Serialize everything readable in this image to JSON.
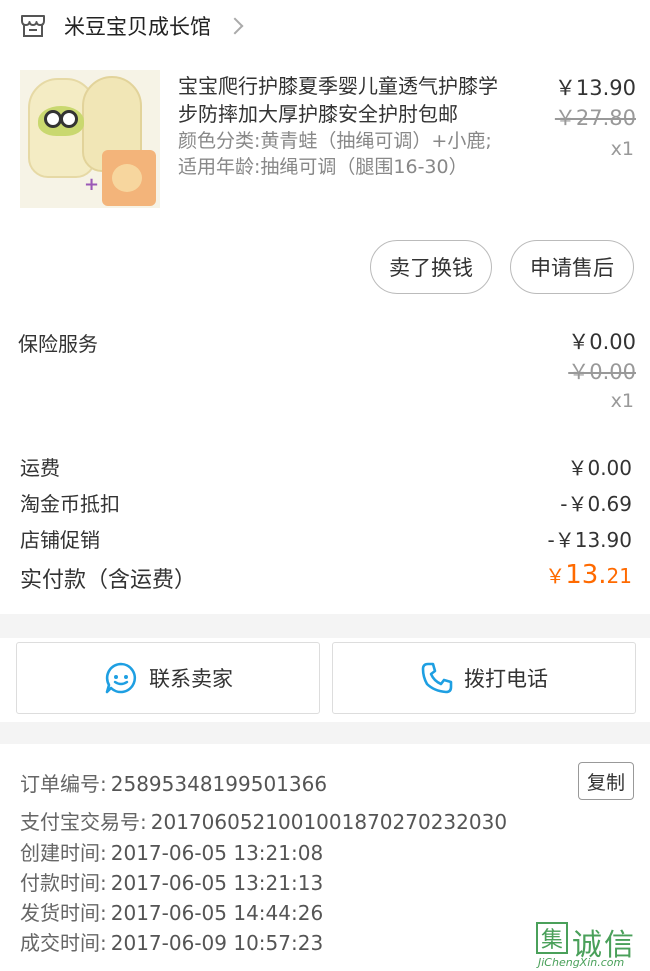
{
  "shop": {
    "name": "米豆宝贝成长馆",
    "icon": "store-icon"
  },
  "product": {
    "title": "宝宝爬行护膝夏季婴儿童透气护膝学步防摔加大厚护膝安全护肘包邮",
    "sku": "颜色分类:黄青蛙（抽绳可调）+小鹿;适用年龄:抽绳可调（腿围16-30）",
    "price": "￥13.90",
    "original_price": "￥27.80",
    "quantity": "x1",
    "actions": {
      "sell": "卖了换钱",
      "after_sale": "申请售后"
    }
  },
  "insurance": {
    "label": "保险服务",
    "price": "￥0.00",
    "original_price": "￥0.00",
    "quantity": "x1"
  },
  "fees": [
    {
      "label": "运费",
      "value": "￥0.00"
    },
    {
      "label": "淘金币抵扣",
      "value": "-￥0.69"
    },
    {
      "label": "店铺促销",
      "value": "-￥13.90"
    }
  ],
  "payment": {
    "label": "实付款（含运费）",
    "currency": "￥",
    "integer": "13.",
    "decimal": "21",
    "color": "#ff6a00"
  },
  "buttons": {
    "contact": "联系卖家",
    "call": "拨打电话",
    "contact_icon": "chat-smile-icon",
    "call_icon": "phone-icon"
  },
  "order_info": {
    "order_no_label": "订单编号:",
    "order_no": "25895348199501366",
    "copy": "复制",
    "alipay_label": "支付宝交易号:",
    "alipay_no": "2017060521001001870270232030",
    "created_label": "创建时间:",
    "created": "2017-06-05 13:21:08",
    "paid_label": "付款时间:",
    "paid": "2017-06-05 13:21:13",
    "shipped_label": "发货时间:",
    "shipped": "2017-06-05 14:44:26",
    "closed_label": "成交时间:",
    "closed": "2017-06-09 10:57:23"
  },
  "watermark": {
    "box_char": "集",
    "text": "诚信",
    "url": "JiChengXin.com"
  }
}
